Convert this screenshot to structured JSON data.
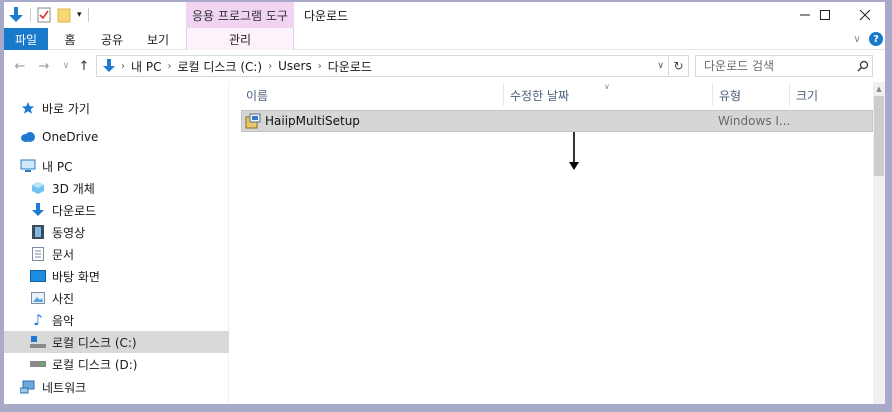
{
  "titlebar": {
    "context_tab": "응용 프로그램 도구",
    "title": "다운로드"
  },
  "ribbon": {
    "tabs": [
      "파일",
      "홈",
      "공유",
      "보기"
    ],
    "context_tab": "관리"
  },
  "address": {
    "breadcrumbs": [
      "내 PC",
      "로컬 디스크 (C:)",
      "Users",
      "다운로드"
    ]
  },
  "search": {
    "placeholder": "다운로드 검색"
  },
  "nav": {
    "quick_access": "바로 가기",
    "onedrive": "OneDrive",
    "this_pc": "내 PC",
    "items": [
      "3D 개체",
      "다운로드",
      "동영상",
      "문서",
      "바탕 화면",
      "사진",
      "음악",
      "로컬 디스크 (C:)",
      "로컬 디스크 (D:)"
    ],
    "network": "네트워크"
  },
  "columns": [
    "이름",
    "수정한 날짜",
    "유형",
    "크기"
  ],
  "files": [
    {
      "name": "HaiipMultiSetup",
      "type": "Windows I..."
    }
  ]
}
